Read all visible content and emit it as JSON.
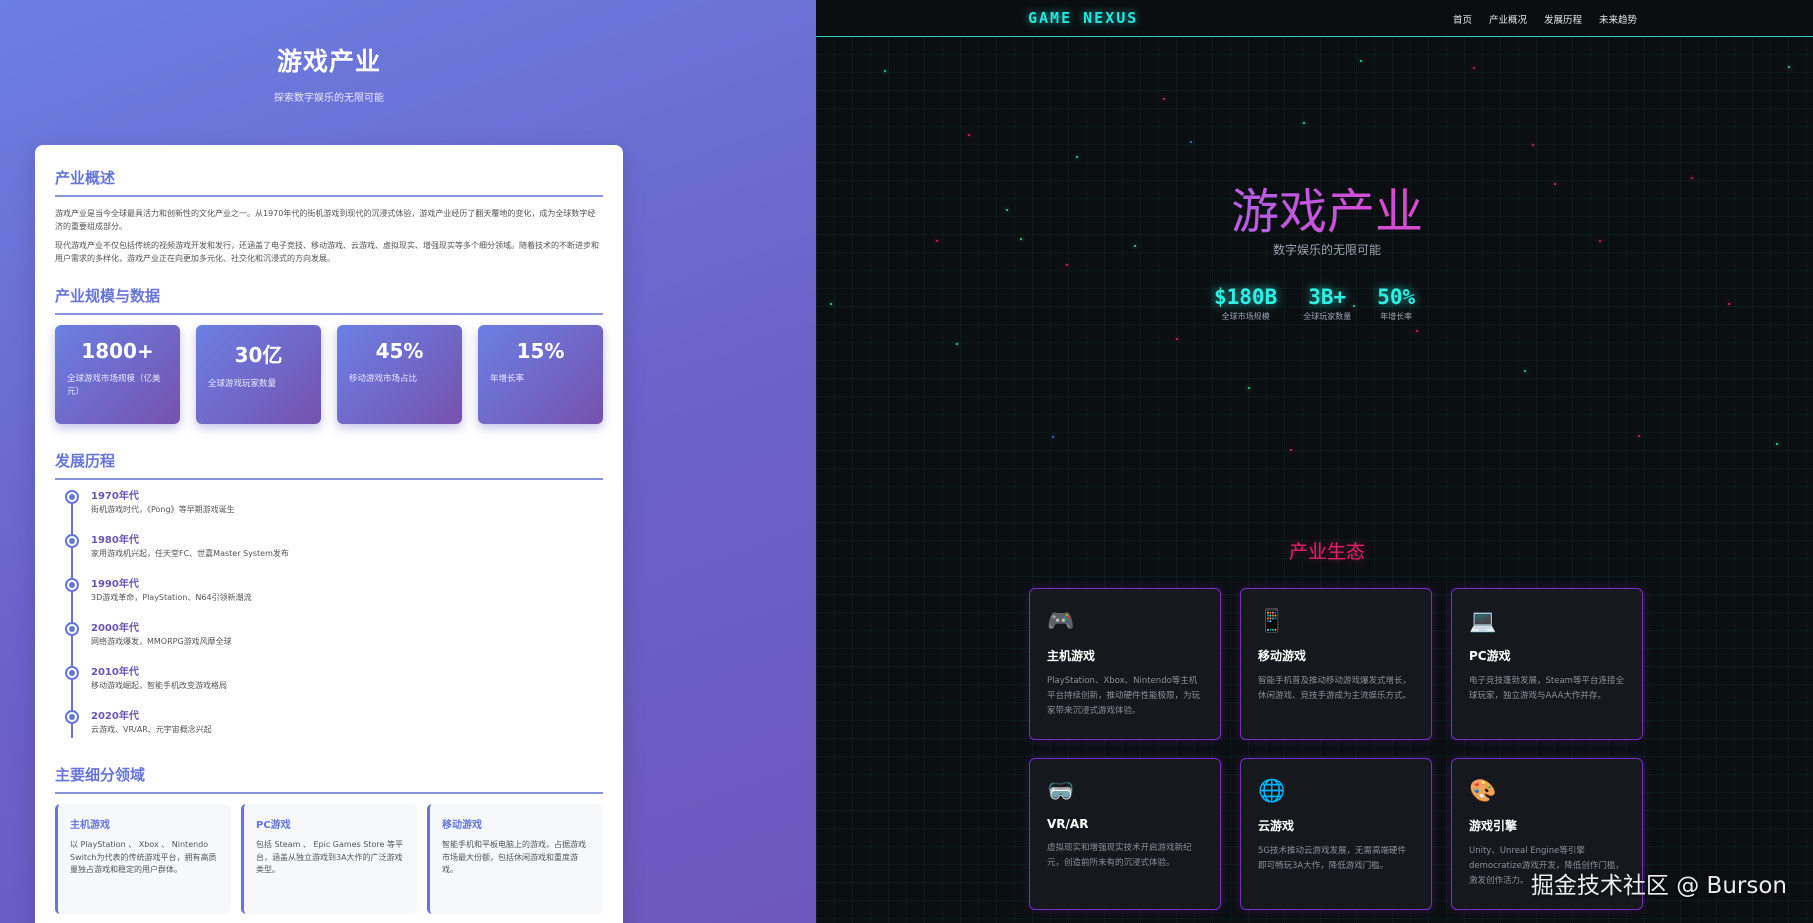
{
  "left": {
    "hero_title": "游戏产业",
    "hero_subtitle": "探索数字娱乐的无限可能",
    "overview": {
      "heading": "产业概述",
      "paragraphs": [
        "游戏产业是当今全球最具活力和创新性的文化产业之一。从1970年代的街机游戏到现代的沉浸式体验，游戏产业经历了翻天覆地的变化，成为全球数字经济的重要组成部分。",
        "现代游戏产业不仅包括传统的视频游戏开发和发行，还涵盖了电子竞技、移动游戏、云游戏、虚拟现实、增强现实等多个细分领域。随着技术的不断进步和用户需求的多样化，游戏产业正在向更加多元化、社交化和沉浸式的方向发展。"
      ]
    },
    "scale": {
      "heading": "产业规模与数据",
      "stats": [
        {
          "num": "1800+",
          "label": "全球游戏市场规模（亿美元）"
        },
        {
          "num": "30亿",
          "label": "全球游戏玩家数量"
        },
        {
          "num": "45%",
          "label": "移动游戏市场占比"
        },
        {
          "num": "15%",
          "label": "年增长率"
        }
      ]
    },
    "history": {
      "heading": "发展历程",
      "items": [
        {
          "year": "1970年代",
          "desc": "街机游戏时代，《Pong》等早期游戏诞生"
        },
        {
          "year": "1980年代",
          "desc": "家用游戏机兴起，任天堂FC、世嘉Master System发布"
        },
        {
          "year": "1990年代",
          "desc": "3D游戏革命，PlayStation、N64引领新潮流"
        },
        {
          "year": "2000年代",
          "desc": "网络游戏爆发，MMORPG游戏风靡全球"
        },
        {
          "year": "2010年代",
          "desc": "移动游戏崛起，智能手机改变游戏格局"
        },
        {
          "year": "2020年代",
          "desc": "云游戏、VR/AR、元宇宙概念兴起"
        }
      ]
    },
    "segments": {
      "heading": "主要细分领域",
      "items": [
        {
          "title": "主机游戏",
          "desc": "以 PlayStation 、 Xbox 、 Nintendo Switch为代表的传统游戏平台，拥有高质量独占游戏和稳定的用户群体。"
        },
        {
          "title": "PC游戏",
          "desc": "包括 Steam 、 Epic Games Store 等平台，涵盖从独立游戏到3A大作的广泛游戏类型。"
        },
        {
          "title": "移动游戏",
          "desc": "智能手机和平板电脑上的游戏，占据游戏市场最大份额，包括休闲游戏和重度游戏。"
        }
      ]
    }
  },
  "right": {
    "logo": "GAME NEXUS",
    "menu": [
      "首页",
      "产业概况",
      "发展历程",
      "未来趋势"
    ],
    "title": "游戏产业",
    "subtitle": "数字娱乐的无限可能",
    "stats": [
      {
        "num": "$180B",
        "label": "全球市场规模"
      },
      {
        "num": "3B+",
        "label": "全球玩家数量"
      },
      {
        "num": "50%",
        "label": "年增长率"
      }
    ],
    "eco_title": "产业生态",
    "cards": [
      {
        "icon": "🎮",
        "icon_name": "gamepad-icon",
        "title": "主机游戏",
        "desc": "PlayStation、Xbox、Nintendo等主机平台持续创新，推动硬件性能极限，为玩家带来沉浸式游戏体验。"
      },
      {
        "icon": "📱",
        "icon_name": "mobile-icon",
        "title": "移动游戏",
        "desc": "智能手机普及推动移动游戏爆发式增长，休闲游戏、竞技手游成为主流娱乐方式。"
      },
      {
        "icon": "💻",
        "icon_name": "laptop-icon",
        "title": "PC游戏",
        "desc": "电子竞技蓬勃发展，Steam等平台连接全球玩家，独立游戏与AAA大作并存。"
      },
      {
        "icon": "🥽",
        "icon_name": "vr-headset-icon",
        "title": "VR/AR",
        "desc": "虚拟现实和增强现实技术开启游戏新纪元，创造前所未有的沉浸式体验。"
      },
      {
        "icon": "🌐",
        "icon_name": "globe-icon",
        "title": "云游戏",
        "desc": "5G技术推动云游戏发展，无需高端硬件即可畅玩3A大作，降低游戏门槛。"
      },
      {
        "icon": "🎨",
        "icon_name": "palette-icon",
        "title": "游戏引擎",
        "desc": "Unity、Unreal Engine等引擎democratize游戏开发，降低创作门槛，激发创作活力。"
      }
    ],
    "watermark": "掘金技术社区 @ Burson"
  }
}
